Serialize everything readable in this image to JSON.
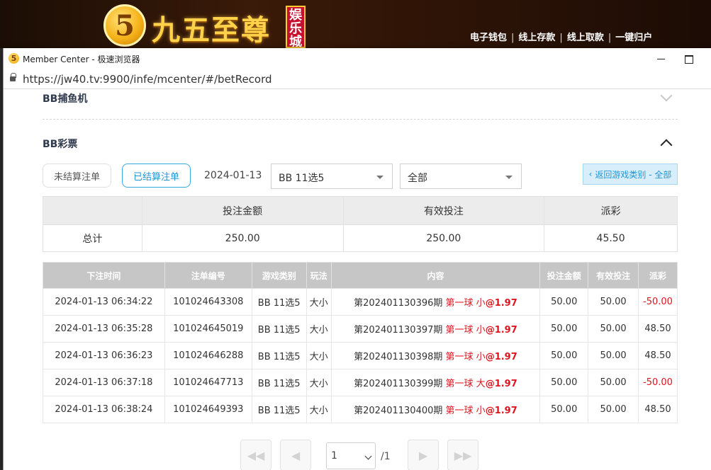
{
  "site": {
    "logo_glyph": "5",
    "logo_title": "九五至尊",
    "logo_badge": "娱乐城",
    "nav": [
      "电子钱包",
      "线上存款",
      "线上取款",
      "一键归户"
    ]
  },
  "window": {
    "title": "Member Center - 极速浏览器",
    "url": "https://jw40.tv:9900/infe/mcenter/#/betRecord",
    "icon": "app-logo-icon"
  },
  "sections": {
    "fish": "BB捕鱼机",
    "lottery": "BB彩票"
  },
  "filters": {
    "unsettled_label": "未结算注单",
    "settled_label": "已结算注单",
    "date": "2024-01-13",
    "game_select": "BB 11选5",
    "type_select": "全部",
    "back_label": "返回游戏类别 - 全部"
  },
  "summary": {
    "headers": [
      "",
      "投注金额",
      "有效投注",
      "派彩"
    ],
    "row": [
      "总计",
      "250.00",
      "250.00",
      "45.50"
    ]
  },
  "records": {
    "headers": [
      "下注时间",
      "注单编号",
      "游戏类别",
      "玩法",
      "内容",
      "投注金额",
      "有效投注",
      "派彩"
    ],
    "rows": [
      {
        "time": "2024-01-13 06:34:22",
        "id": "101024643308",
        "game": "BB 11选5",
        "play": "大小",
        "period": "第202401130396期",
        "ball": "第一球 小",
        "odds": "@1.97",
        "bet": "50.00",
        "valid": "50.00",
        "payout": "-50.00"
      },
      {
        "time": "2024-01-13 06:35:28",
        "id": "101024645019",
        "game": "BB 11选5",
        "play": "大小",
        "period": "第202401130397期",
        "ball": "第一球 小",
        "odds": "@1.97",
        "bet": "50.00",
        "valid": "50.00",
        "payout": "48.50"
      },
      {
        "time": "2024-01-13 06:36:23",
        "id": "101024646288",
        "game": "BB 11选5",
        "play": "大小",
        "period": "第202401130398期",
        "ball": "第一球 小",
        "odds": "@1.97",
        "bet": "50.00",
        "valid": "50.00",
        "payout": "48.50"
      },
      {
        "time": "2024-01-13 06:37:18",
        "id": "101024647713",
        "game": "BB 11选5",
        "play": "大小",
        "period": "第202401130399期",
        "ball": "第一球 大",
        "odds": "@1.97",
        "bet": "50.00",
        "valid": "50.00",
        "payout": "-50.00"
      },
      {
        "time": "2024-01-13 06:38:24",
        "id": "101024649393",
        "game": "BB 11选5",
        "play": "大小",
        "period": "第202401130400期",
        "ball": "第一球 小",
        "odds": "@1.97",
        "bet": "50.00",
        "valid": "50.00",
        "payout": "48.50"
      }
    ]
  },
  "pager": {
    "current": "1",
    "total": "/1",
    "first": "◀◀",
    "prev": "◀",
    "next": "▶",
    "last": "▶▶"
  },
  "colors": {
    "accent": "#1e96d6",
    "negative": "#e0141e",
    "header_gray": "#c6c6c6"
  }
}
